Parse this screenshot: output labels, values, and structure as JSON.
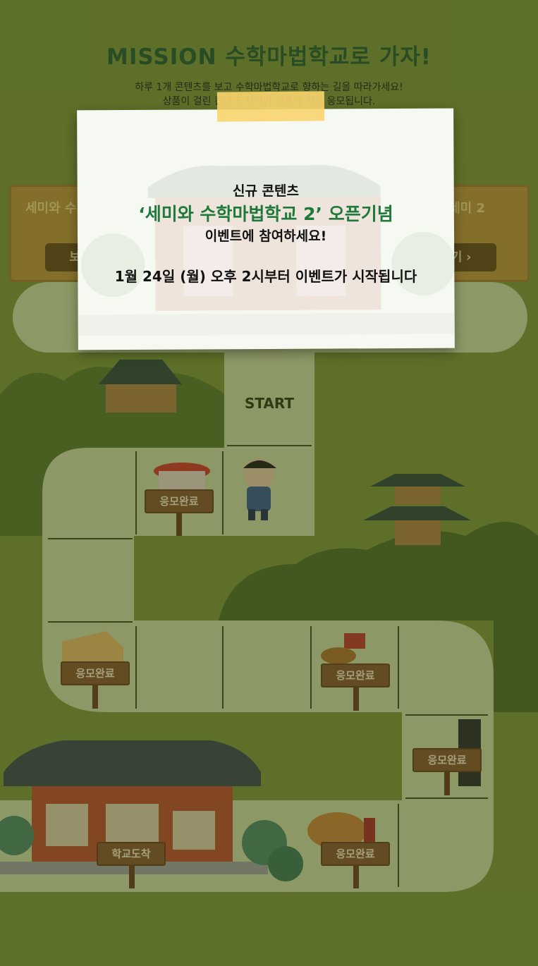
{
  "header": {
    "title": "MISSION 수학마법학교로 가자!",
    "desc_line1": "하루 1개 콘텐츠를 보고 수학마법학교로 향하는 길을 따라가세요!",
    "desc_line2": "상품이 걸린 칸에 도착하면 상품에 자동 응모됩니다."
  },
  "side_cards": {
    "left": {
      "label": "세미와 수",
      "button": "보러"
    },
    "right": {
      "label": "세미 2",
      "button": "기 ›"
    }
  },
  "board": {
    "start": "START",
    "signs": [
      "응모완료",
      "응모완료",
      "응모완료",
      "응모완료",
      "응모완료"
    ],
    "destination": "학교도착"
  },
  "modal": {
    "line1": "신규 콘텐츠",
    "line2": "‘세미와 수학마법학교 2’ 오픈기념",
    "line3": "이벤트에 참여하세요!",
    "line4": "1월 24일 (월) 오후 2시부터 이벤트가 시작됩니다"
  },
  "colors": {
    "background": "#809a3a",
    "title": "#1f5a30",
    "highlight": "#1d7a3b",
    "tape": "#f8d46e"
  }
}
